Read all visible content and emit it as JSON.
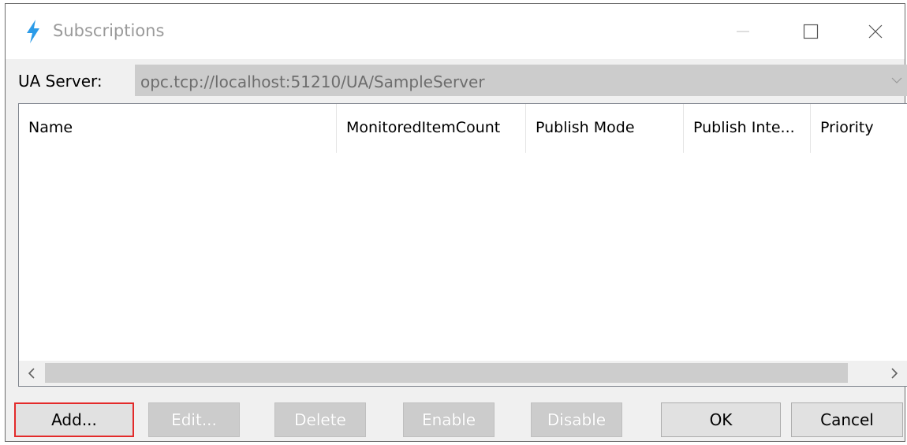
{
  "window": {
    "title": "Subscriptions",
    "icon": "lightning-icon",
    "accent_color": "#2b9be8"
  },
  "titlebar_buttons": {
    "minimize": "minimize-icon",
    "maximize": "maximize-icon",
    "close": "close-icon"
  },
  "server": {
    "label": "UA Server:",
    "value": "opc.tcp://localhost:51210/UA/SampleServer"
  },
  "table": {
    "columns": [
      "Name",
      "MonitoredItemCount",
      "Publish Mode",
      "Publish Inte...",
      "Priority"
    ],
    "rows": []
  },
  "buttons": {
    "add": "Add...",
    "edit": "Edit...",
    "delete": "Delete",
    "enable": "Enable",
    "disable": "Disable",
    "ok": "OK",
    "cancel": "Cancel"
  },
  "highlight_color": "#e32a2a"
}
